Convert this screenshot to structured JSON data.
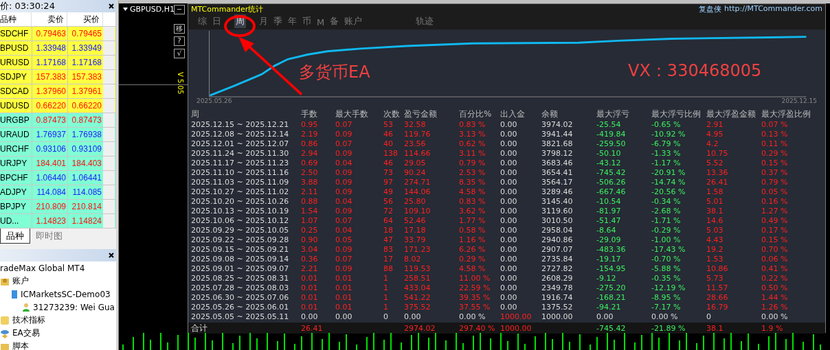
{
  "market_watch": {
    "title": "价: 03:30:24",
    "columns": [
      "品种",
      "卖价",
      "买价"
    ],
    "rows": [
      {
        "symbol": "SDCHF",
        "bid": "0.79463",
        "ask": "0.79465",
        "rising": false,
        "color": "#ffff40"
      },
      {
        "symbol": "BPUSD",
        "bid": "1.33948",
        "ask": "1.33949",
        "rising": true,
        "color": "#ffff40"
      },
      {
        "symbol": "URUSD",
        "bid": "1.17168",
        "ask": "1.17168",
        "rising": true,
        "color": "#ffff40"
      },
      {
        "symbol": "SDJPY",
        "bid": "157.383",
        "ask": "157.383",
        "rising": false,
        "color": "#ffff40"
      },
      {
        "symbol": "SDCAD",
        "bid": "1.37960",
        "ask": "1.37961",
        "rising": false,
        "color": "#ffff40"
      },
      {
        "symbol": "UDUSD",
        "bid": "0.66220",
        "ask": "0.66220",
        "rising": false,
        "color": "#ffff40"
      },
      {
        "symbol": "URGBP",
        "bid": "0.87473",
        "ask": "0.87473",
        "rising": false,
        "color": "#80ffd4"
      },
      {
        "symbol": "URAUD",
        "bid": "1.76937",
        "ask": "1.76938",
        "rising": true,
        "color": "#80ffd4"
      },
      {
        "symbol": "URCHF",
        "bid": "0.93106",
        "ask": "0.93109",
        "rising": true,
        "color": "#80ffd4"
      },
      {
        "symbol": "URJPY",
        "bid": "184.401",
        "ask": "184.403",
        "rising": false,
        "color": "#80ffd4"
      },
      {
        "symbol": "BPCHF",
        "bid": "1.06440",
        "ask": "1.06441",
        "rising": true,
        "color": "#80ffd4"
      },
      {
        "symbol": "ADJPY",
        "bid": "114.084",
        "ask": "114.085",
        "rising": true,
        "color": "#80ffd4"
      },
      {
        "symbol": "BPJPY",
        "bid": "210.809",
        "ask": "210.814",
        "rising": false,
        "color": "#80ffd4"
      },
      {
        "symbol": "UD...",
        "bid": "1.14823",
        "ask": "1.14824",
        "rising": false,
        "color": "#80ffd4"
      }
    ],
    "tabs": [
      {
        "label": "品种",
        "selected": true
      },
      {
        "label": "即时图",
        "selected": false
      }
    ]
  },
  "navigator": {
    "items": [
      {
        "label": "radeMax Global MT4",
        "children": [
          {
            "label": "账户",
            "kind": "accounts",
            "children": [
              {
                "label": "ICMarketsSC-Demo03",
                "kind": "server",
                "children": [
                  {
                    "label": "31273239: Wei Gua",
                    "kind": "user"
                  }
                ]
              }
            ]
          },
          {
            "label": "技术指标",
            "kind": "indicators"
          },
          {
            "label": "EA交易",
            "kind": "experts"
          },
          {
            "label": "脚本",
            "kind": "scripts"
          }
        ]
      }
    ]
  },
  "chart_window": {
    "title": "GBPUSD,H1",
    "side_buttons": [
      "−",
      "移",
      "?",
      "√"
    ],
    "version": "V 5.05"
  },
  "stats_panel": {
    "title": "MTCommander统计",
    "brand": "复盘侠",
    "url": "http://MTCommander.com",
    "tabs": [
      {
        "label": "综",
        "selected": false
      },
      {
        "label": "日",
        "selected": false
      },
      {
        "label": "周",
        "selected": true
      },
      {
        "label": "月",
        "selected": false
      },
      {
        "label": "季",
        "selected": false
      },
      {
        "label": "年",
        "selected": false
      },
      {
        "label": "币",
        "selected": false
      },
      {
        "label": "M",
        "selected": false
      },
      {
        "label": "备",
        "selected": false
      },
      {
        "label": "账户",
        "selected": false
      },
      {
        "label": "轨迹",
        "selected": false
      }
    ],
    "equity_start": "2025.05.26",
    "equity_end": "2025.12.15",
    "columns": [
      {
        "label": "周",
        "color": "#dcdcdc",
        "kind": "text"
      },
      {
        "label": "手数",
        "color": "#ff2020",
        "kind": "value"
      },
      {
        "label": "最大手数",
        "color": "#ff2020",
        "kind": "value"
      },
      {
        "label": "次数",
        "color": "#ff2020",
        "kind": "value"
      },
      {
        "label": "盈亏金额",
        "color": "#ff2020",
        "kind": "value"
      },
      {
        "label": "百分比%",
        "color": "#ff2020",
        "kind": "value"
      },
      {
        "label": "出入金",
        "color": "#dcdcdc",
        "kind": "flow"
      },
      {
        "label": "余额",
        "color": "#dcdcdc",
        "kind": "value"
      },
      {
        "label": "最大浮亏",
        "color": "#3cf060",
        "kind": "value"
      },
      {
        "label": "最大浮亏比例",
        "color": "#3cf060",
        "kind": "value"
      },
      {
        "label": "最大浮盈金额",
        "color": "#ff2020",
        "kind": "value"
      },
      {
        "label": "最大浮盈比例",
        "color": "#ff2020",
        "kind": "value"
      }
    ],
    "rows": [
      {
        "opening": false,
        "cells": [
          "2025.12.15 ~ 2025.12.21",
          "0.95",
          "0.07",
          "53",
          "32.58",
          "0.83 %",
          "0.00",
          "3974.02",
          "-25.54",
          "-0.65 %",
          "2.91",
          "0.07 %"
        ]
      },
      {
        "opening": false,
        "cells": [
          "2025.12.08 ~ 2025.12.14",
          "2.19",
          "0.09",
          "46",
          "119.76",
          "3.13 %",
          "0.00",
          "3941.44",
          "-419.84",
          "-10.92 %",
          "4.95",
          "0.13 %"
        ]
      },
      {
        "opening": false,
        "cells": [
          "2025.12.01 ~ 2025.12.07",
          "0.86",
          "0.07",
          "40",
          "23.56",
          "0.62 %",
          "0.00",
          "3821.68",
          "-259.50",
          "-6.79 %",
          "4.2",
          "0.11 %"
        ]
      },
      {
        "opening": false,
        "cells": [
          "2025.11.24 ~ 2025.11.30",
          "2.94",
          "0.09",
          "138",
          "114.66",
          "3.11 %",
          "0.00",
          "3798.12",
          "-50.10",
          "-1.33 %",
          "10.75",
          "0.29 %"
        ]
      },
      {
        "opening": false,
        "cells": [
          "2025.11.17 ~ 2025.11.23",
          "0.69",
          "0.04",
          "46",
          "29.05",
          "0.79 %",
          "0.00",
          "3683.46",
          "-43.12",
          "-1.17 %",
          "5.52",
          "0.15 %"
        ]
      },
      {
        "opening": false,
        "cells": [
          "2025.11.10 ~ 2025.11.16",
          "2.50",
          "0.09",
          "73",
          "90.24",
          "2.53 %",
          "0.00",
          "3654.41",
          "-745.42",
          "-20.91 %",
          "13.36",
          "0.37 %"
        ]
      },
      {
        "opening": false,
        "cells": [
          "2025.11.03 ~ 2025.11.09",
          "3.88",
          "0.09",
          "97",
          "274.71",
          "8.35 %",
          "0.00",
          "3564.17",
          "-506.26",
          "-14.74 %",
          "26.41",
          "0.79 %"
        ]
      },
      {
        "opening": false,
        "cells": [
          "2025.10.27 ~ 2025.11.02",
          "2.11",
          "0.09",
          "49",
          "144.06",
          "4.58 %",
          "0.00",
          "3289.46",
          "-667.46",
          "-20.56 %",
          "1.58",
          "0.05 %"
        ]
      },
      {
        "opening": false,
        "cells": [
          "2025.10.20 ~ 2025.10.26",
          "0.88",
          "0.04",
          "56",
          "25.80",
          "0.83 %",
          "0.00",
          "3145.40",
          "-10.54",
          "-0.34 %",
          "5.01",
          "0.16 %"
        ]
      },
      {
        "opening": false,
        "cells": [
          "2025.10.13 ~ 2025.10.19",
          "1.54",
          "0.09",
          "72",
          "109.10",
          "3.62 %",
          "0.00",
          "3119.60",
          "-81.97",
          "-2.68 %",
          "38.1",
          "1.27 %"
        ]
      },
      {
        "opening": false,
        "cells": [
          "2025.10.06 ~ 2025.10.12",
          "1.07",
          "0.07",
          "64",
          "52.46",
          "1.77 %",
          "0.00",
          "3010.50",
          "-51.47",
          "-1.71 %",
          "14.6",
          "0.49 %"
        ]
      },
      {
        "opening": false,
        "cells": [
          "2025.09.29 ~ 2025.10.05",
          "0.25",
          "0.04",
          "18",
          "17.18",
          "0.58 %",
          "0.00",
          "2958.04",
          "-8.64",
          "-0.29 %",
          "5.03",
          "0.17 %"
        ]
      },
      {
        "opening": false,
        "cells": [
          "2025.09.22 ~ 2025.09.28",
          "0.90",
          "0.05",
          "47",
          "33.79",
          "1.16 %",
          "0.00",
          "2940.86",
          "-29.09",
          "-1.00 %",
          "4.43",
          "0.15 %"
        ]
      },
      {
        "opening": false,
        "cells": [
          "2025.09.15 ~ 2025.09.21",
          "3.04",
          "0.09",
          "83",
          "171.23",
          "6.26 %",
          "0.00",
          "2907.07",
          "-483.36",
          "-17.43 %",
          "19.2",
          "0.70 %"
        ]
      },
      {
        "opening": false,
        "cells": [
          "2025.09.08 ~ 2025.09.14",
          "0.36",
          "0.07",
          "17",
          "8.02",
          "0.29 %",
          "0.00",
          "2735.84",
          "-19.17",
          "-0.70 %",
          "1.53",
          "0.06 %"
        ]
      },
      {
        "opening": false,
        "cells": [
          "2025.09.01 ~ 2025.09.07",
          "2.21",
          "0.09",
          "88",
          "119.53",
          "4.58 %",
          "0.00",
          "2727.82",
          "-154.95",
          "-5.88 %",
          "10.86",
          "0.41 %"
        ]
      },
      {
        "opening": false,
        "cells": [
          "2025.08.25 ~ 2025.08.31",
          "0.01",
          "0.01",
          "1",
          "258.51",
          "11.00 %",
          "0.00",
          "2608.29",
          "-9.12",
          "-0.35 %",
          "5.73",
          "0.22 %"
        ]
      },
      {
        "opening": false,
        "cells": [
          "2025.07.28 ~ 2025.08.03",
          "0.01",
          "0.01",
          "1",
          "433.04",
          "22.59 %",
          "0.00",
          "2349.78",
          "-275.20",
          "-12.19 %",
          "11.57",
          "0.50 %"
        ]
      },
      {
        "opening": false,
        "cells": [
          "2025.06.30 ~ 2025.07.06",
          "0.01",
          "0.01",
          "1",
          "541.22",
          "39.35 %",
          "0.00",
          "1916.74",
          "-168.21",
          "-8.95 %",
          "28.66",
          "1.44 %"
        ]
      },
      {
        "opening": false,
        "cells": [
          "2025.05.26 ~ 2025.06.01",
          "0.01",
          "0.01",
          "1",
          "375.52",
          "37.55 %",
          "0.00",
          "1375.52",
          "-94.21",
          "-7.17 %",
          "16.79",
          "1.26 %"
        ]
      },
      {
        "opening": true,
        "cells": [
          "2025.05.05 ~ 2025.05.11",
          "0.00",
          "0.00",
          "0",
          "0.00",
          "0.00 %",
          "1000.00",
          "1000.00",
          "0.00",
          "0.00 %",
          "0",
          "0.00 %"
        ]
      }
    ],
    "total": {
      "label": "合计",
      "cells": [
        "26.41",
        "",
        "",
        "2974.02",
        "297.40 %",
        "1000.00",
        "",
        "-745.42",
        "-21.89 %",
        "38.1",
        "1.9 %"
      ]
    }
  },
  "annotations": {
    "caption": "多货币EA",
    "contact": "VX：330468005"
  }
}
